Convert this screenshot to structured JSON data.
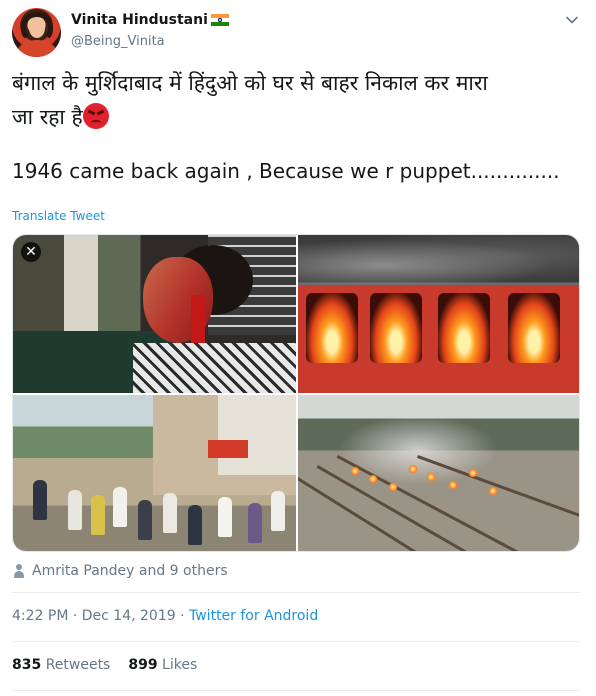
{
  "author": {
    "name": "Vinita Hindustani",
    "handle": "@Being_Vinita",
    "flag_icon": "india-flag-icon"
  },
  "tweet": {
    "hindi_line1": "बंगाल के मुर्शिदाबाद में हिंदुओ को घर से बाहर निकाल कर मारा",
    "hindi_line2": "जा रहा है",
    "emoji": "angry-face-emoji",
    "english": "1946 came back again , Because we r puppet..............",
    "translate_label": "Translate Tweet"
  },
  "media": {
    "close_glyph": "✕",
    "photos": [
      "injured-woman-photo",
      "burning-train-photo",
      "street-crowd-photo",
      "railway-fires-photo"
    ]
  },
  "likers": {
    "text": "Amrita Pandey and 9 others"
  },
  "meta": {
    "time_date": "4:22 PM · Dec 14, 2019 · ",
    "source": "Twitter for Android"
  },
  "stats": {
    "retweets_count": "835",
    "retweets_label": "Retweets",
    "likes_count": "899",
    "likes_label": "Likes"
  },
  "colors": {
    "link": "#1b95e0",
    "muted": "#657786",
    "text": "#14171a"
  }
}
